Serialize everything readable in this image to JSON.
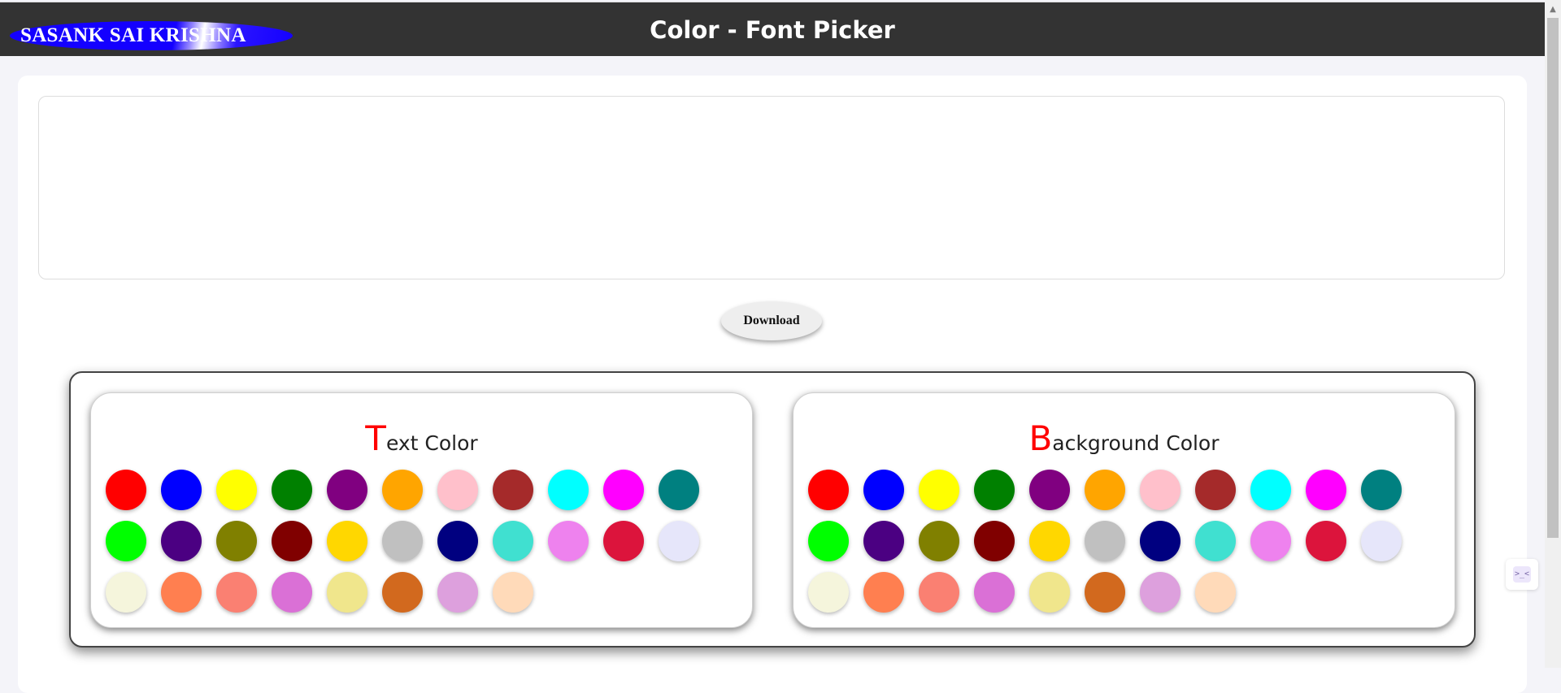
{
  "header": {
    "brand": "SASANK SAI KRISHNA",
    "title": "Color - Font Picker"
  },
  "actions": {
    "download_label": "Download"
  },
  "text_color_panel": {
    "title_initial": "T",
    "title_rest": "ext Color"
  },
  "background_color_panel": {
    "title_initial": "B",
    "title_rest": "ackground Color"
  },
  "colors": [
    "#ff0000",
    "#0000ff",
    "#ffff00",
    "#008000",
    "#800080",
    "#ffa500",
    "#ffc0cb",
    "#a52a2a",
    "#00ffff",
    "#ff00ff",
    "#008080",
    "#00ff00",
    "#4b0082",
    "#808000",
    "#800000",
    "#ffd700",
    "#c0c0c0",
    "#000080",
    "#40e0d0",
    "#ee82ee",
    "#dc143c",
    "#e6e6fa",
    "#f5f5dc",
    "#ff7f50",
    "#fa8072",
    "#da70d6",
    "#f0e68c",
    "#d2691e",
    "#dda0dd",
    "#ffdab9"
  ],
  "icons": {
    "scroll_up": "arrow-up-icon",
    "side_widget": "terminal-icon"
  }
}
